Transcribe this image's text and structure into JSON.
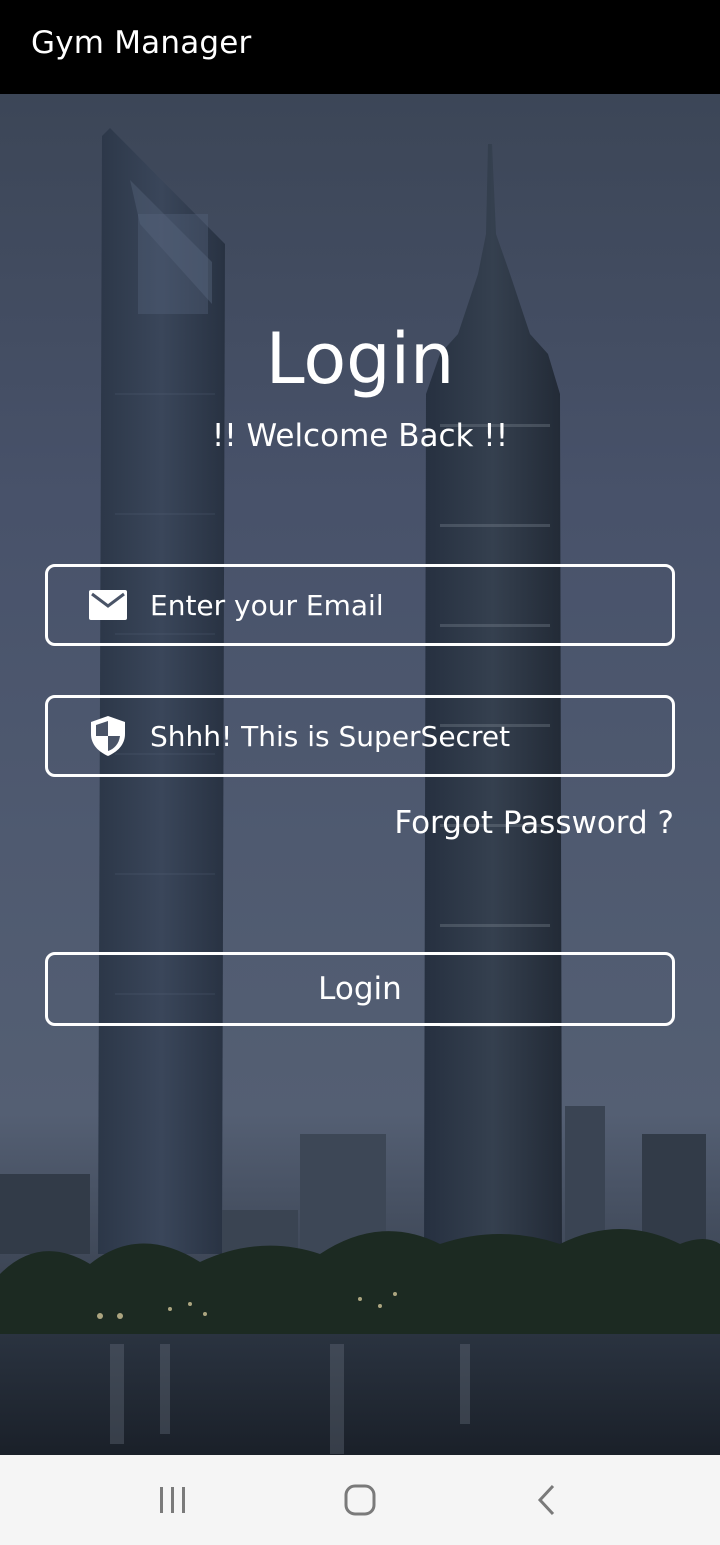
{
  "app_bar": {
    "title": "Gym Manager"
  },
  "login": {
    "title": "Login",
    "subtitle": "!! Welcome Back !!",
    "email": {
      "placeholder": "Enter your Email",
      "icon": "envelope-icon"
    },
    "password": {
      "placeholder": "Shhh! This is SuperSecret",
      "icon": "shield-icon"
    },
    "forgot_label": "Forgot Password ?",
    "button_label": "Login"
  },
  "nav_bar": {
    "recents": "recent-apps-icon",
    "home": "home-icon",
    "back": "back-icon"
  },
  "colors": {
    "app_bar_bg": "#000000",
    "text": "#ffffff",
    "nav_bg": "#f5f5f5",
    "nav_icon": "#7a7a7a"
  }
}
